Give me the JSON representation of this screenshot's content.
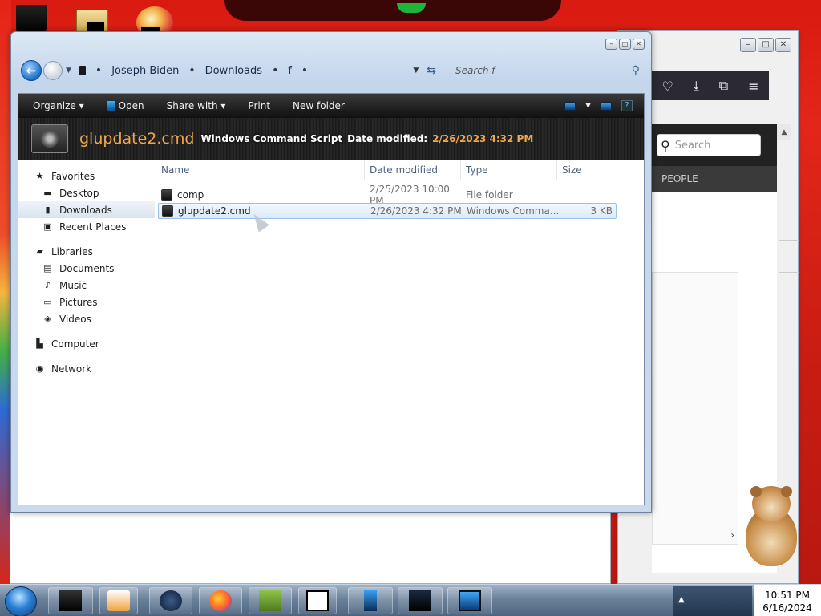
{
  "explorer": {
    "breadcrumb": [
      "Joseph Biden",
      "Downloads",
      "f"
    ],
    "search_placeholder": "Search f",
    "commands": {
      "organize": "Organize",
      "open": "Open",
      "share": "Share with",
      "print": "Print",
      "new_folder": "New folder"
    },
    "details": {
      "file_name": "glupdate2.cmd",
      "file_type": "Windows Command Script",
      "modified_label": "Date modified:",
      "modified_value": "2/26/2023 4:32 PM"
    },
    "nav": {
      "favorites": {
        "label": "Favorites",
        "items": [
          "Desktop",
          "Downloads",
          "Recent Places"
        ]
      },
      "libraries": {
        "label": "Libraries",
        "items": [
          "Documents",
          "Music",
          "Pictures",
          "Videos"
        ]
      },
      "computer": "Computer",
      "network": "Network"
    },
    "columns": {
      "name": "Name",
      "date": "Date modified",
      "type": "Type",
      "size": "Size"
    },
    "rows": [
      {
        "name": "comp",
        "date": "2/25/2023 10:00 PM",
        "type": "File folder",
        "size": ""
      },
      {
        "name": "glupdate2.cmd",
        "date": "2/26/2023 4:32 PM",
        "type": "Windows Comma...",
        "size": "3 KB"
      }
    ]
  },
  "browser": {
    "search_placeholder": "Search",
    "people_label": "PEOPLE"
  },
  "taskbar": {
    "time": "10:51 PM",
    "date": "6/16/2024",
    "icons": [
      "window-icon",
      "media-player-icon",
      "globe-icon",
      "firefox-icon",
      "hamster-box-icon",
      "7zip-icon",
      "device-icon",
      "monitor-graph-icon",
      "display-icon"
    ]
  },
  "colors": {
    "accent": "#f2a84a",
    "selection": "#dbe9f8",
    "desktop": "#d81a10"
  }
}
